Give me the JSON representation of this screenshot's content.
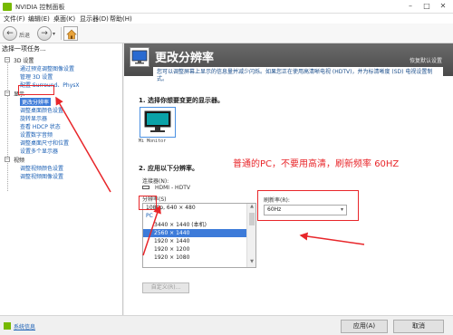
{
  "window": {
    "title": "NVIDIA 控制面板",
    "minimize": "–",
    "maximize": "□",
    "close": "✕"
  },
  "menu": [
    "文件(F)",
    "编辑(E)",
    "桌面(K)",
    "显示器(D)",
    "帮助(H)"
  ],
  "toolbar": {
    "back_label": "后退",
    "dropdown": "▾"
  },
  "left_pane": {
    "title": "选择一项任务...",
    "tree": [
      {
        "label": "3D 设置",
        "type": "category"
      },
      {
        "label": "通过预览调整图像设置",
        "type": "link"
      },
      {
        "label": "管理 3D 设置",
        "type": "link"
      },
      {
        "label": "配置 Surround、PhysX",
        "type": "link"
      },
      {
        "label": "显示",
        "type": "category"
      },
      {
        "label": "更改分辨率",
        "type": "selected"
      },
      {
        "label": "调整桌面颜色设置",
        "type": "link"
      },
      {
        "label": "旋转显示器",
        "type": "link"
      },
      {
        "label": "查看 HDCP 状态",
        "type": "link"
      },
      {
        "label": "设置数字音频",
        "type": "link"
      },
      {
        "label": "调整桌面尺寸和位置",
        "type": "link"
      },
      {
        "label": "设置多个显示器",
        "type": "link"
      },
      {
        "label": "视频",
        "type": "category"
      },
      {
        "label": "调整视频颜色设置",
        "type": "link"
      },
      {
        "label": "调整视频图像设置",
        "type": "link"
      }
    ]
  },
  "content": {
    "title": "更改分辨率",
    "restore": "恢复默认设置",
    "description": "您可以调整屏幕上显示的信息量并减少闪烁。如果您正在使用高清晰电视 (HDTV)，并为标清晰度 (SD) 电视设置制式。",
    "step1": "1.  选择你想要变更的显示器。",
    "monitor_name": "Mi Monitor",
    "step2": "2.  应用以下分辨率。",
    "connector_label": "连接器(N):",
    "connector_value": "HDMI - HDTV",
    "resolution_label": "分辨率(S)",
    "resolutions": [
      {
        "label": "1080p, 640 × 480",
        "kind": "item"
      },
      {
        "label": "PC",
        "kind": "group"
      },
      {
        "label": "3440 × 1440 (本机)",
        "kind": "item"
      },
      {
        "label": "2560 × 1440",
        "kind": "selected"
      },
      {
        "label": "1920 × 1440",
        "kind": "item"
      },
      {
        "label": "1920 × 1200",
        "kind": "item"
      },
      {
        "label": "1920 × 1080",
        "kind": "item"
      }
    ],
    "customize_button": "自定义(R)...",
    "refresh_label": "刷新率(R):",
    "refresh_value": "60Hz",
    "annotation": "普通的PC，不要用高清，刷新频率 60HZ"
  },
  "footer": {
    "system_info": "系统信息",
    "apply": "应用(A)",
    "cancel": "取消"
  },
  "colors": {
    "accent": "#3d7bd9",
    "annotation": "#e8262a",
    "nvidia": "#76b900"
  }
}
